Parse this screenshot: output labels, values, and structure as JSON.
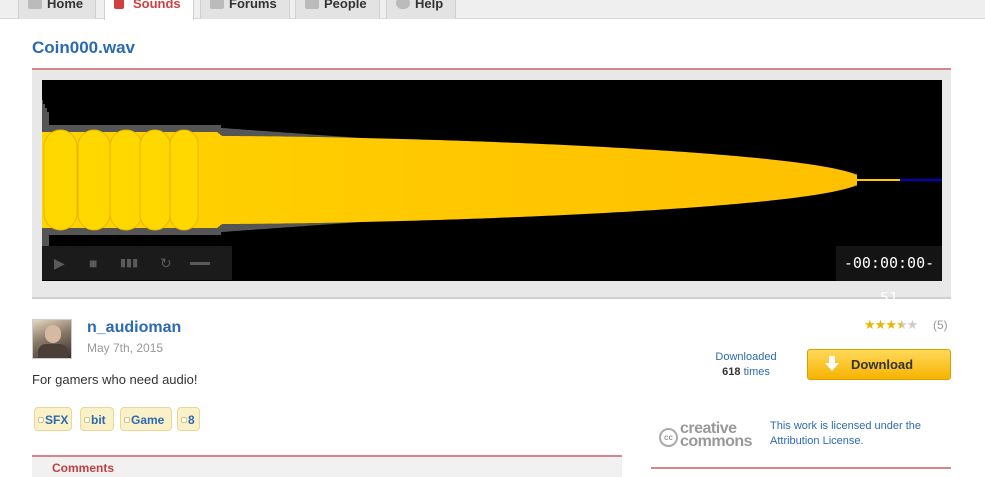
{
  "nav": {
    "tabs": [
      {
        "label": "Home",
        "icon": "home-icon"
      },
      {
        "label": "Sounds",
        "icon": "sounds-icon"
      },
      {
        "label": "Forums",
        "icon": "forums-icon"
      },
      {
        "label": "People",
        "icon": "people-icon"
      },
      {
        "label": "Help",
        "icon": "help-icon"
      }
    ],
    "active_tab": "Sounds"
  },
  "sound": {
    "title": "Coin000.wav",
    "time_display": "-00:00:00-51",
    "waveform_color": "#ffc800",
    "tail_color": "#0000cc"
  },
  "player_controls": [
    "play-icon",
    "stop-icon",
    "spectrogram-icon",
    "loop-icon",
    "measure-icon"
  ],
  "user": {
    "name": "n_audioman",
    "date": "May 7th, 2015"
  },
  "description": "For gamers who need audio!",
  "tags": [
    "SFX",
    "bit",
    "Game",
    "8"
  ],
  "comments": {
    "label": "Comments"
  },
  "rating": {
    "stars": 3.5,
    "max": 5,
    "count": "(5)"
  },
  "download": {
    "downloaded_label": "Downloaded",
    "count": "618",
    "times_label": "times",
    "button_label": "Download"
  },
  "license": {
    "logo_line1": "creative",
    "logo_line2": "commons",
    "logo_cc": "cc",
    "text": "This work is licensed under the Attribution License."
  },
  "colors": {
    "accent": "#2c6ab0",
    "rule": "#d4868a",
    "active_tab": "#d04040",
    "button": "#f6b300"
  }
}
